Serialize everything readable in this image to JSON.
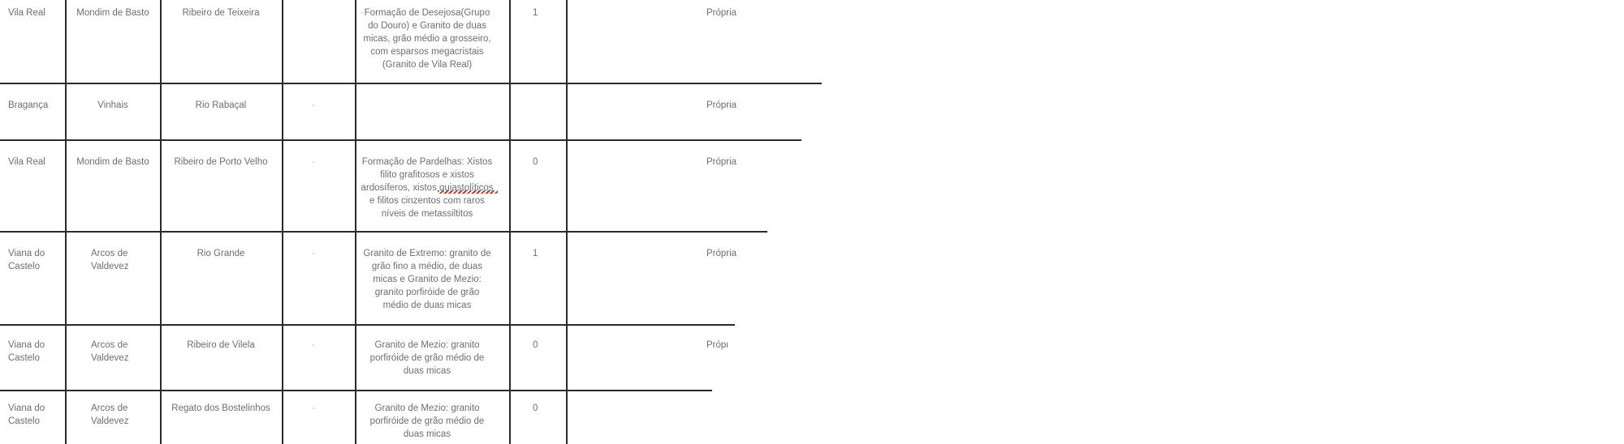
{
  "rows": [
    {
      "distrito": "Vila Real",
      "concelho": "Mondim de Basto",
      "curso_agua": "Ribeiro de Teixeira",
      "col4": "-",
      "geologia": [
        "Formação de Desejosa(Grupo",
        "do Douro) e Granito de duas",
        "micas, grão médio a grosseiro,",
        "com esparsos megacristais",
        "(Granito de Vila Real)"
      ],
      "valor": "1",
      "tipo": "Própria"
    },
    {
      "distrito": "Bragança",
      "concelho": "Vinhais",
      "curso_agua": "Rio Rabaçal",
      "col4": "-",
      "geologia": [],
      "valor": "",
      "tipo": "Própria"
    },
    {
      "distrito": "Vila Real",
      "concelho": "Mondim de Basto",
      "curso_agua": "Ribeiro de Porto Velho",
      "col4": "-",
      "geologia": [
        "Formação de Pardelhas: Xistos",
        "filito grafitosos e xistos",
        "ardosíferos, xistos quiastolíticos",
        "e filitos cinzentos com raros",
        "níveis de metassiltitos"
      ],
      "valor": "0",
      "tipo": "Própria"
    },
    {
      "distrito": [
        "Viana do",
        "Castelo"
      ],
      "concelho": [
        "Arcos de",
        "Valdevez"
      ],
      "curso_agua": "Rio Grande",
      "col4": "-",
      "geologia": [
        "Granito de Extremo: granito de",
        "grão fino a médio, de duas",
        "micas e Granito de Mezio:",
        "granito porfiróide de grão",
        "médio de duas micas"
      ],
      "valor": "1",
      "tipo": "Própria"
    },
    {
      "distrito": [
        "Viana do",
        "Castelo"
      ],
      "concelho": [
        "Arcos de",
        "Valdevez"
      ],
      "curso_agua": "Ribeiro de Vilela",
      "col4": "-",
      "geologia": [
        "Granito de Mezio: granito",
        "porfiróide de grão médio de",
        "duas micas"
      ],
      "valor": "0",
      "tipo": "Própria"
    },
    {
      "distrito": [
        "Viana do",
        "Castelo"
      ],
      "concelho": [
        "Arcos de",
        "Valdevez"
      ],
      "curso_agua": "Regato dos Bostelinhos",
      "col4": "-",
      "geologia": [
        "Granito de Mezio: granito",
        "porfiróide de grão médio de",
        "duas micas"
      ],
      "valor": "0",
      "tipo": ""
    }
  ]
}
